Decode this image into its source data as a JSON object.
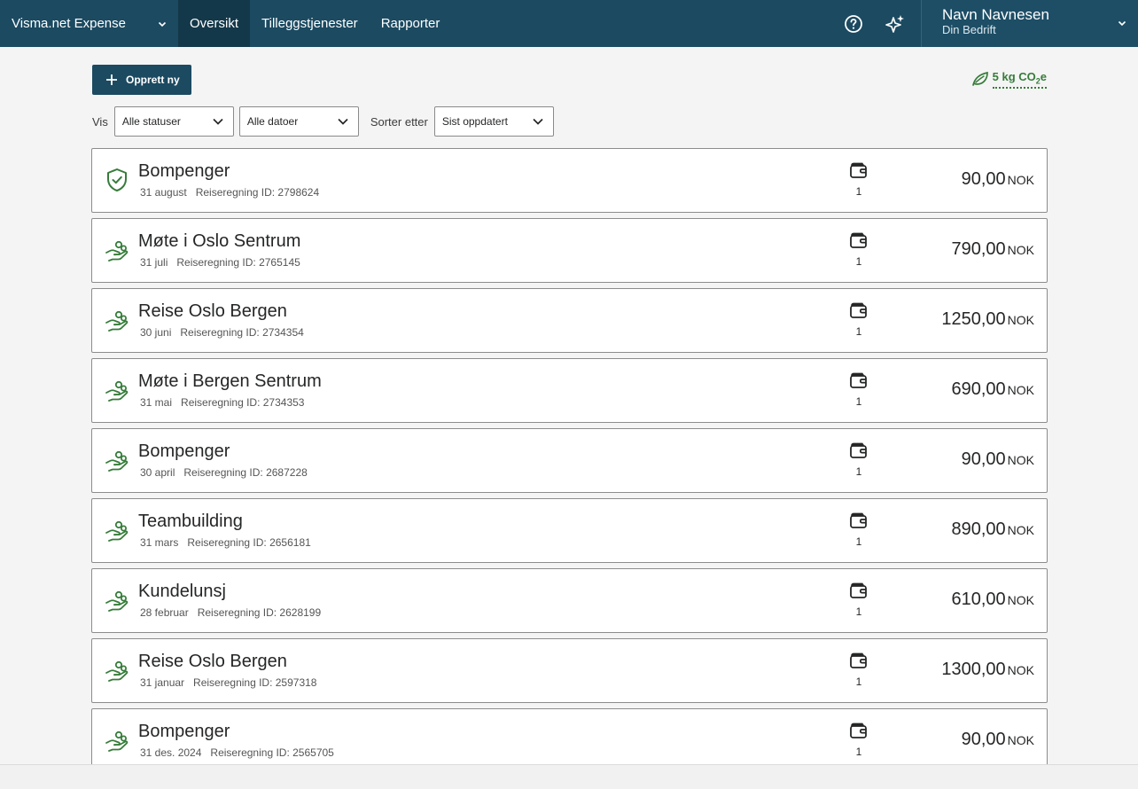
{
  "header": {
    "app_name": "Visma.net Expense",
    "tabs": [
      {
        "label": "Oversikt",
        "active": true
      },
      {
        "label": "Tilleggstjenester",
        "active": false
      },
      {
        "label": "Rapporter",
        "active": false
      }
    ],
    "user": {
      "name": "Navn Navnesen",
      "company": "Din Bedrift"
    },
    "icons": {
      "help": "question-circle-icon",
      "assistant": "sparkle-icon",
      "menu": "chevron-down-icon"
    }
  },
  "actions": {
    "create_label": "Opprett ny",
    "co2_value": "5 kg CO",
    "co2_sub": "2",
    "co2_suffix": "e"
  },
  "filters": {
    "show_label": "Vis",
    "status_value": "Alle statuser",
    "date_value": "Alle datoer",
    "sort_label": "Sorter etter",
    "sort_value": "Sist oppdatert"
  },
  "colors": {
    "brand": "#1b4a61",
    "status_green": "#367c3a"
  },
  "reports": [
    {
      "title": "Bompenger",
      "date": "31 august",
      "id_text": "Reiseregning ID: 2798624",
      "receipts": "1",
      "amount": "90,00",
      "currency": "NOK",
      "status_icon": "shield-check-icon"
    },
    {
      "title": "Møte i Oslo Sentrum",
      "date": "31 juli",
      "id_text": "Reiseregning ID: 2765145",
      "receipts": "1",
      "amount": "790,00",
      "currency": "NOK",
      "status_icon": "hand-coins-icon"
    },
    {
      "title": "Reise Oslo Bergen",
      "date": "30 juni",
      "id_text": "Reiseregning ID: 2734354",
      "receipts": "1",
      "amount": "1250,00",
      "currency": "NOK",
      "status_icon": "hand-coins-icon"
    },
    {
      "title": "Møte i Bergen Sentrum",
      "date": "31 mai",
      "id_text": "Reiseregning ID: 2734353",
      "receipts": "1",
      "amount": "690,00",
      "currency": "NOK",
      "status_icon": "hand-coins-icon"
    },
    {
      "title": "Bompenger",
      "date": "30 april",
      "id_text": "Reiseregning ID: 2687228",
      "receipts": "1",
      "amount": "90,00",
      "currency": "NOK",
      "status_icon": "hand-coins-icon"
    },
    {
      "title": "Teambuilding",
      "date": "31 mars",
      "id_text": "Reiseregning ID: 2656181",
      "receipts": "1",
      "amount": "890,00",
      "currency": "NOK",
      "status_icon": "hand-coins-icon"
    },
    {
      "title": "Kundelunsj",
      "date": "28 februar",
      "id_text": "Reiseregning ID: 2628199",
      "receipts": "1",
      "amount": "610,00",
      "currency": "NOK",
      "status_icon": "hand-coins-icon"
    },
    {
      "title": "Reise Oslo Bergen",
      "date": "31 januar",
      "id_text": "Reiseregning ID: 2597318",
      "receipts": "1",
      "amount": "1300,00",
      "currency": "NOK",
      "status_icon": "hand-coins-icon"
    },
    {
      "title": "Bompenger",
      "date": "31 des. 2024",
      "id_text": "Reiseregning ID: 2565705",
      "receipts": "1",
      "amount": "90,00",
      "currency": "NOK",
      "status_icon": "hand-coins-icon"
    }
  ]
}
